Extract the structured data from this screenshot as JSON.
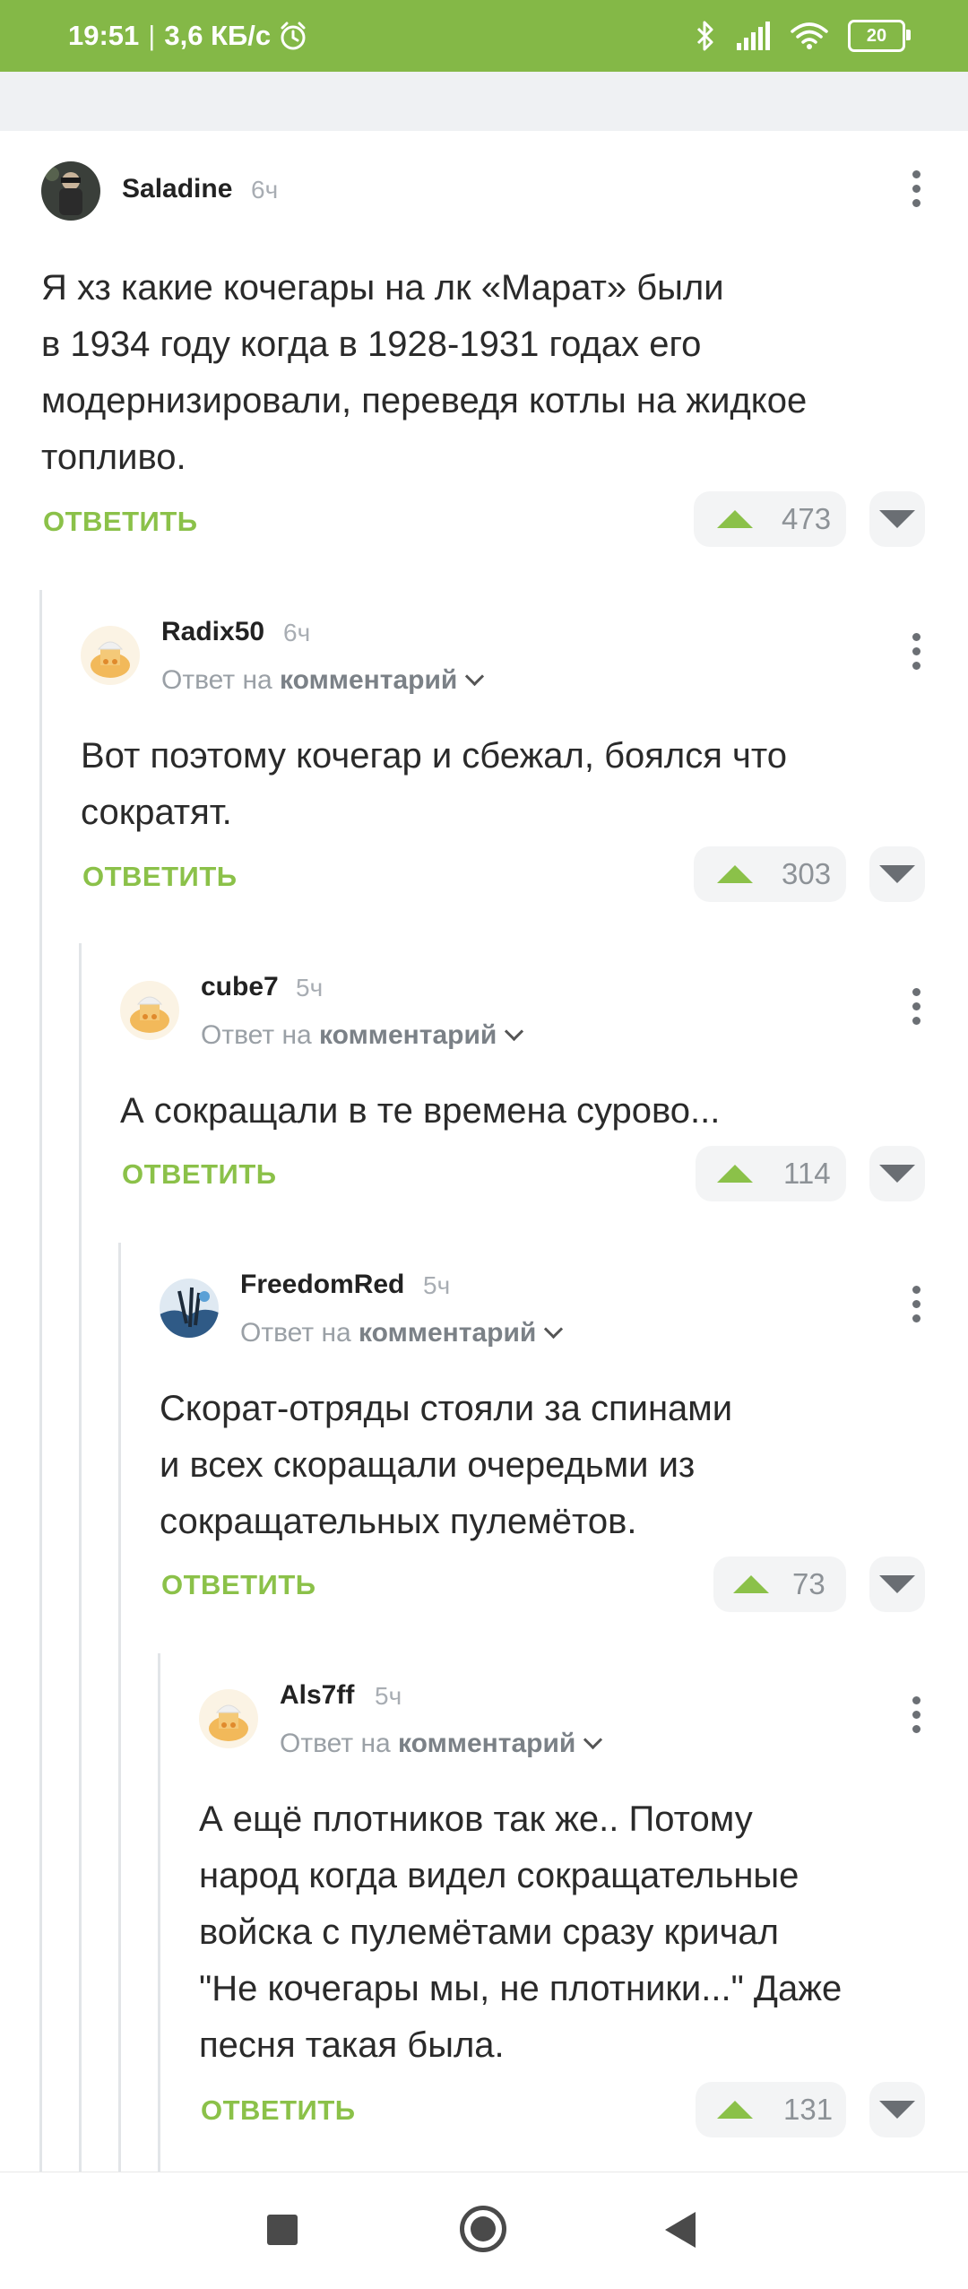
{
  "status_bar": {
    "time": "19:51",
    "network_speed": "3,6 КБ/с",
    "battery": "20",
    "icons": [
      "alarm-icon",
      "bluetooth-icon",
      "signal-icon",
      "wifi-icon",
      "battery-icon"
    ]
  },
  "colors": {
    "accent": "#8bc149",
    "status_bar": "#84b847",
    "vote_bg": "#f3f4f5"
  },
  "comments": [
    {
      "author": "Saladine",
      "time": "6ч",
      "reply_to_prefix": "",
      "reply_to_target": "",
      "lines": [
        "Я хз какие кочегары на лк «Марат» были",
        "в 1934 году когда в 1928-1931 годах его",
        "модернизировали, переведя котлы на жидкое",
        "топливо."
      ],
      "reply_label": "ОТВЕТИТЬ",
      "score": "473"
    },
    {
      "author": "Radix50",
      "time": "6ч",
      "reply_to_prefix": "Ответ на ",
      "reply_to_target": "комментарий",
      "lines": [
        "Вот поэтому кочегар и сбежал, боялся что",
        "сократят."
      ],
      "reply_label": "ОТВЕТИТЬ",
      "score": "303"
    },
    {
      "author": "cube7",
      "time": "5ч",
      "reply_to_prefix": "Ответ на ",
      "reply_to_target": "комментарий",
      "lines": [
        "А сокращали в те времена сурово..."
      ],
      "reply_label": "ОТВЕТИТЬ",
      "score": "114"
    },
    {
      "author": "FreedomRed",
      "time": "5ч",
      "reply_to_prefix": "Ответ на ",
      "reply_to_target": "комментарий",
      "lines": [
        "Скорат-отряды стояли за спинами",
        "и всех скоращали очередьми из",
        "сокращательных пулемётов."
      ],
      "reply_label": "ОТВЕТИТЬ",
      "score": "73"
    },
    {
      "author": "Als7ff",
      "time": "5ч",
      "reply_to_prefix": "Ответ на ",
      "reply_to_target": "комментарий",
      "lines": [
        "А ещё плотников так же.. Потому",
        "народ когда видел сокращательные",
        "войска с пулемётами сразу кричал",
        "\"Не кочегары мы, не плотники...\" Даже",
        "песня такая была."
      ],
      "reply_label": "ОТВЕТИТЬ",
      "score": "131"
    }
  ]
}
